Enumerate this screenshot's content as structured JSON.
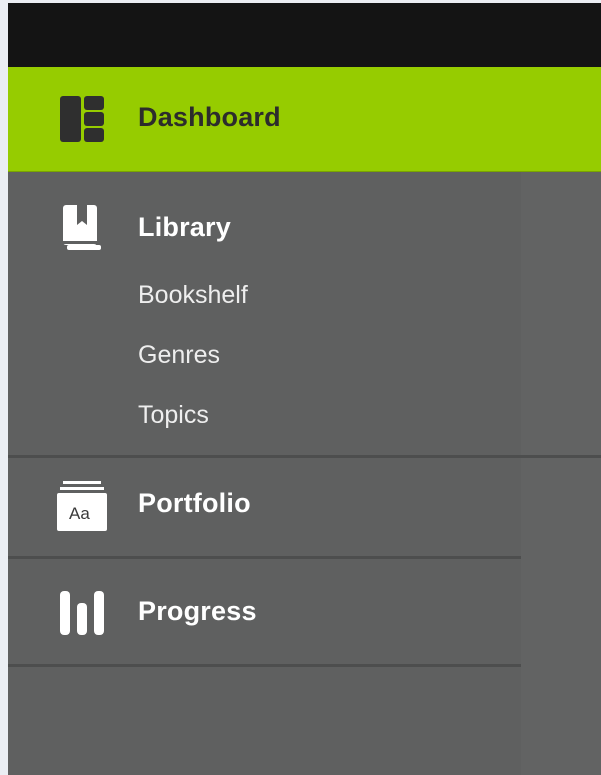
{
  "nav": {
    "dashboard": {
      "label": "Dashboard",
      "icon": "dashboard-icon"
    },
    "library": {
      "label": "Library",
      "icon": "book-icon",
      "children": [
        {
          "label": "Bookshelf"
        },
        {
          "label": "Genres"
        },
        {
          "label": "Topics"
        }
      ]
    },
    "portfolio": {
      "label": "Portfolio",
      "icon": "portfolio-icon",
      "icon_text": "Aa"
    },
    "progress": {
      "label": "Progress",
      "icon": "progress-bars-icon"
    }
  },
  "colors": {
    "accent": "#96cc00",
    "sidebar_bg": "#5f6060",
    "topbar_bg": "#141414",
    "active_text": "#2c2c2c",
    "text": "#ffffff"
  }
}
